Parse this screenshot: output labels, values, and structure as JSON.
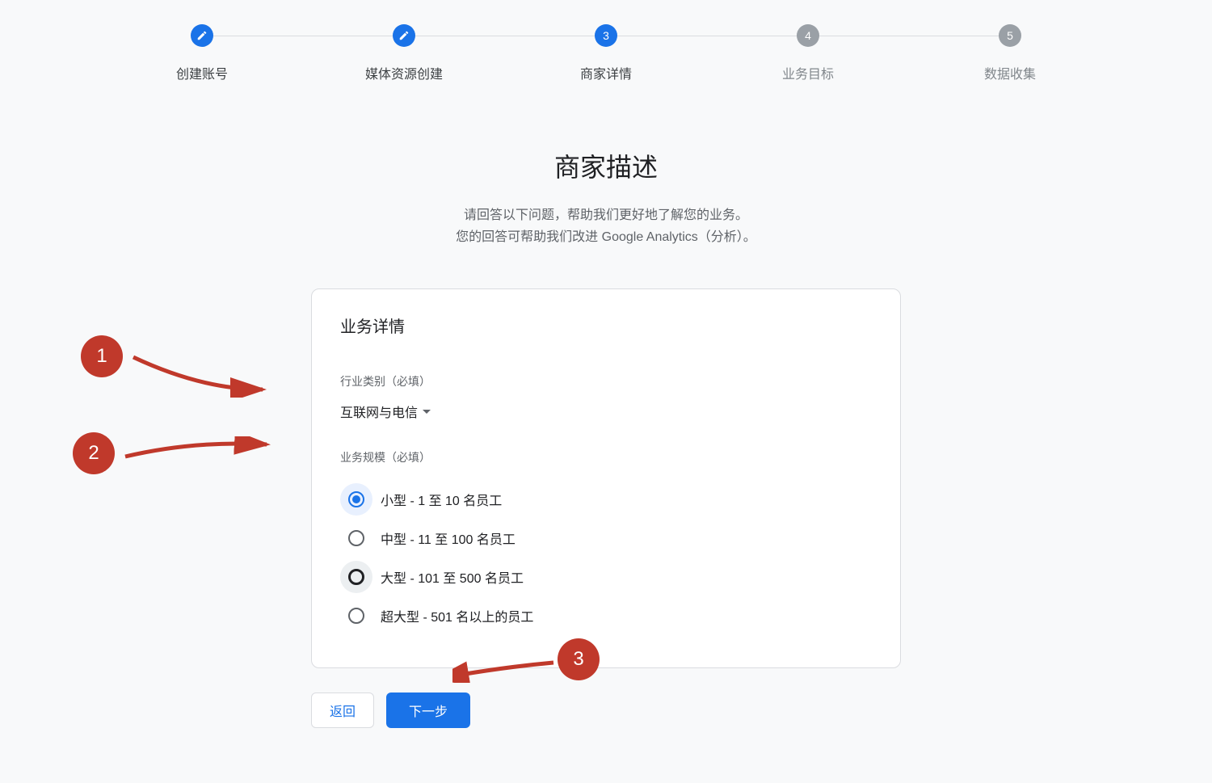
{
  "stepper": {
    "steps": [
      {
        "label": "创建账号",
        "state": "completed"
      },
      {
        "label": "媒体资源创建",
        "state": "completed"
      },
      {
        "label": "商家详情",
        "state": "active",
        "number": "3"
      },
      {
        "label": "业务目标",
        "state": "pending",
        "number": "4"
      },
      {
        "label": "数据收集",
        "state": "pending",
        "number": "5"
      }
    ]
  },
  "heading": {
    "title": "商家描述",
    "subtitle_line1": "请回答以下问题，帮助我们更好地了解您的业务。",
    "subtitle_line2": "您的回答可帮助我们改进 Google Analytics（分析）。"
  },
  "card": {
    "title": "业务详情",
    "industry": {
      "label": "行业类别（必填）",
      "value": "互联网与电信"
    },
    "scale": {
      "label": "业务规模（必填）",
      "options": [
        {
          "label": "小型 - 1 至 10 名员工",
          "selected": true
        },
        {
          "label": "中型 - 11 至 100 名员工",
          "selected": false
        },
        {
          "label": "大型 - 101 至 500 名员工",
          "selected": false,
          "hover": true
        },
        {
          "label": "超大型 - 501 名以上的员工",
          "selected": false
        }
      ]
    }
  },
  "buttons": {
    "back": "返回",
    "next": "下一步"
  },
  "annotations": {
    "marker1": "1",
    "marker2": "2",
    "marker3": "3"
  }
}
